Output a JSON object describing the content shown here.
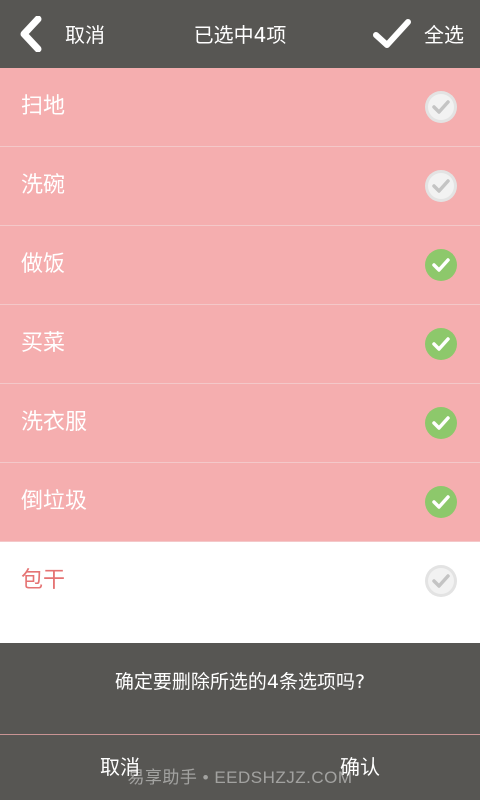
{
  "topbar": {
    "cancel_label": "取消",
    "title": "已选中4项",
    "select_all_label": "全选",
    "back_icon": "chevron-left-icon",
    "select_all_icon": "checkmark-icon"
  },
  "items": [
    {
      "label": "扫地",
      "checked": false
    },
    {
      "label": "洗碗",
      "checked": false
    },
    {
      "label": "做饭",
      "checked": true
    },
    {
      "label": "买菜",
      "checked": true
    },
    {
      "label": "洗衣服",
      "checked": true
    },
    {
      "label": "倒垃圾",
      "checked": true
    },
    {
      "label": "包干",
      "checked": false
    }
  ],
  "dialog": {
    "message": "确定要删除所选的4条选项吗?",
    "cancel_label": "取消",
    "confirm_label": "确认"
  },
  "watermark": "易享助手 • EEDSHZJZ.COM",
  "colors": {
    "header_bg": "#575653",
    "selected_row_bg": "#f5aeaf",
    "checked_green": "#8dc86b",
    "unchecked_gray": "#d9d9d9",
    "white_row_text": "#e57373"
  }
}
